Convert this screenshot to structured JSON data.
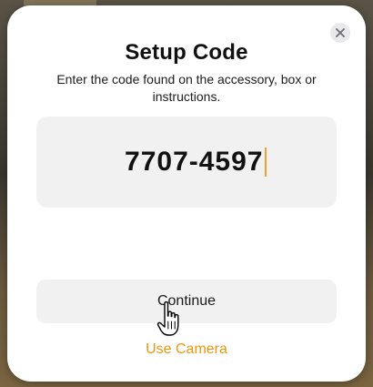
{
  "dialog": {
    "title": "Setup Code",
    "subtitle": "Enter the code found on the accessory, box or instructions.",
    "code_value": "7707-4597",
    "continue_label": "Continue",
    "camera_label": "Use Camera"
  },
  "icons": {
    "close": "close-icon",
    "cursor": "hand-pointer-icon"
  },
  "colors": {
    "accent": "#f0960e",
    "field_bg": "#f1f1f2",
    "sheet_bg": "#ffffff"
  }
}
